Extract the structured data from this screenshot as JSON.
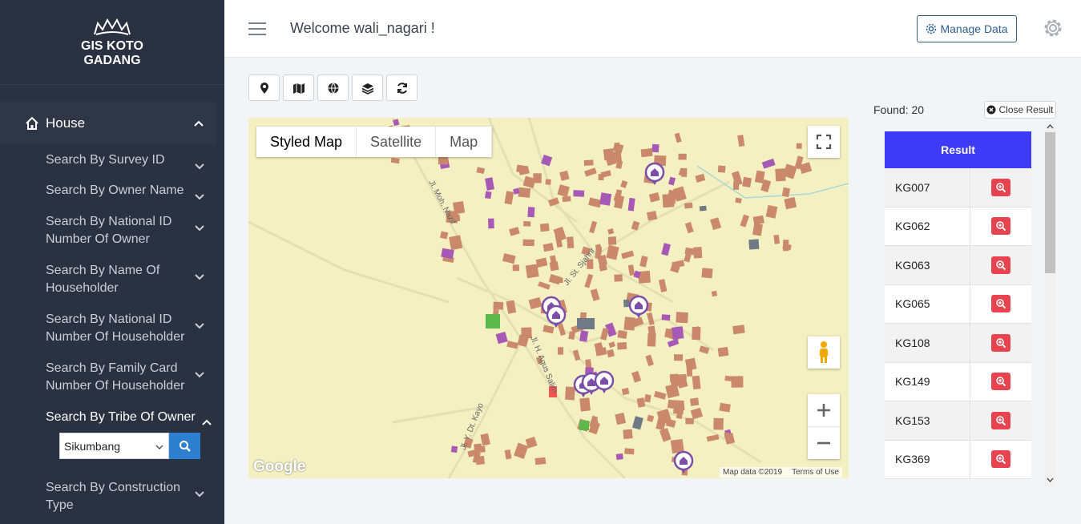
{
  "brand": {
    "line1": "GIS KOTO",
    "line2": "GADANG"
  },
  "sidebar": {
    "house_label": "House",
    "items": [
      {
        "label": "Search By Survey ID"
      },
      {
        "label": "Search By Owner Name"
      },
      {
        "label": "Search By National ID Number Of Owner"
      },
      {
        "label": "Search By Name Of Householder"
      },
      {
        "label": "Search By National ID Number Of Householder"
      },
      {
        "label": "Search By Family Card Number Of Householder"
      },
      {
        "label": "Search By Tribe Of Owner"
      },
      {
        "label": "Search By Construction Type"
      }
    ],
    "tribe_select_value": "Sikumbang"
  },
  "header": {
    "welcome": "Welcome wali_nagari !",
    "manage_data_label": "Manage Data"
  },
  "toolbar": {
    "icons": [
      "map-pin-icon",
      "map-icon",
      "globe-icon",
      "layers-icon",
      "refresh-icon"
    ]
  },
  "map": {
    "types": [
      "Styled Map",
      "Satellite",
      "Map"
    ],
    "selected_type": "Styled Map",
    "attribution": "Map data ©2019",
    "terms": "Terms of Use",
    "google_logo": "Google",
    "streets": [
      "Jl. Moh. Nazif",
      "Jl. St. Sjahrir",
      "Jl. H. Agus Salim",
      "Jl. Y. Dt. Kayo"
    ]
  },
  "results": {
    "found_label": "Found: 20",
    "close_label": "Close Result",
    "header": "Result",
    "items": [
      "KG007",
      "KG062",
      "KG063",
      "KG065",
      "KG108",
      "KG149",
      "KG153",
      "KG369"
    ]
  },
  "colors": {
    "sidebar_bg": "#2a3140",
    "result_header": "#3d3bf5",
    "zoom_button": "#e8434f",
    "search_button": "#2f7fd0",
    "map_bg": "#f4f0c2",
    "building": "#c9896a",
    "marker": "#7b4fa8"
  }
}
